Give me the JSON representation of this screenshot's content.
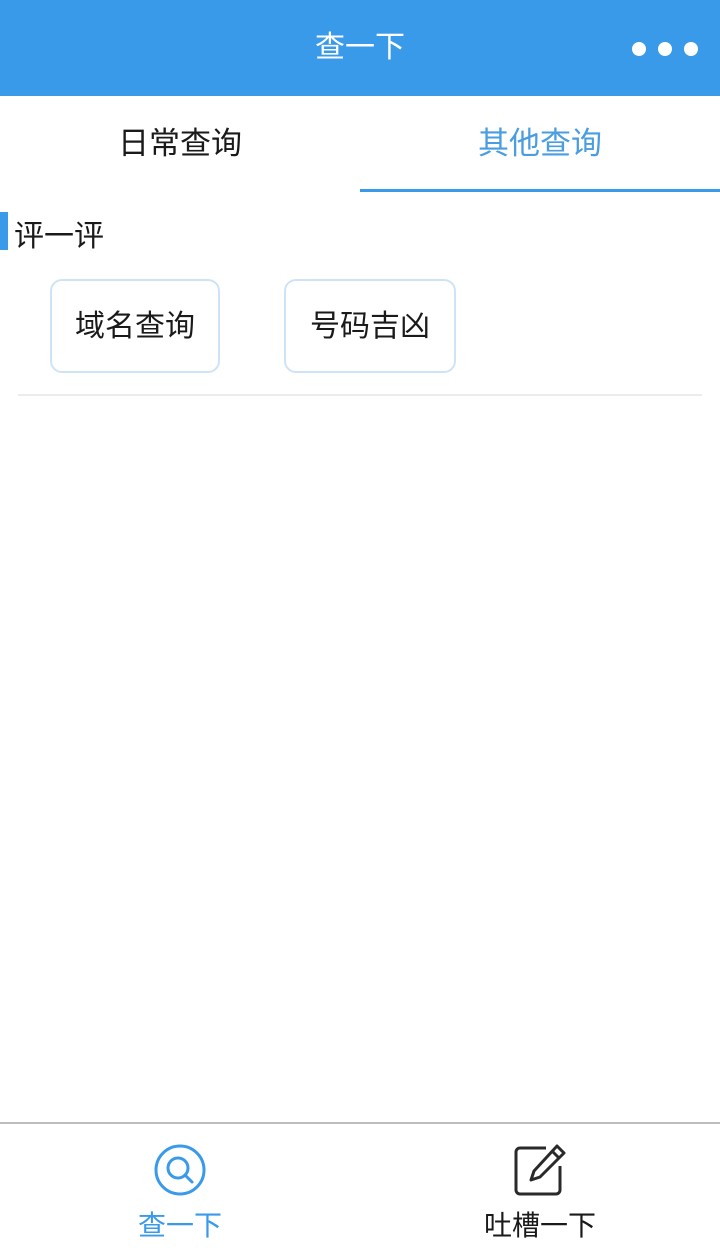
{
  "navbar": {
    "title": "查一下",
    "more_icon": "more-dots-icon"
  },
  "tabs": [
    {
      "label": "日常查询",
      "active": false
    },
    {
      "label": "其他查询",
      "active": true
    }
  ],
  "section": {
    "title": "评一评",
    "buttons": [
      {
        "label": "域名查询"
      },
      {
        "label": "号码吉凶"
      }
    ]
  },
  "tabbar": {
    "items": [
      {
        "label": "查一下",
        "icon": "search-icon",
        "active": true
      },
      {
        "label": "吐槽一下",
        "icon": "edit-icon",
        "active": false
      }
    ]
  },
  "colors": {
    "accent": "#3a9aea",
    "active_text": "#4a9de0",
    "button_border": "#cfe3f7"
  }
}
